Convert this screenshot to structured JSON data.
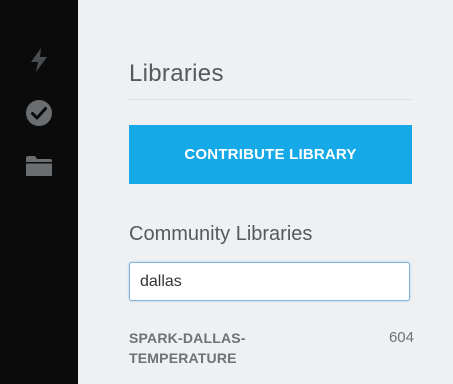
{
  "sidebar": {
    "icons": [
      "flash-icon",
      "verify-check-icon",
      "folder-icon"
    ]
  },
  "libraries": {
    "title": "Libraries",
    "contribute_label": "CONTRIBUTE LIBRARY",
    "community_title": "Community Libraries",
    "search": {
      "value": "dallas",
      "placeholder": ""
    },
    "results": [
      {
        "name_line1": "SPARK-DALLAS-",
        "name_line2": "TEMPERATURE",
        "count": "604"
      }
    ]
  },
  "colors": {
    "rail_bg": "#0b0b0b",
    "panel_bg": "#eef0f1",
    "accent": "#15a9e7",
    "icon_gray": "#5d6164"
  }
}
